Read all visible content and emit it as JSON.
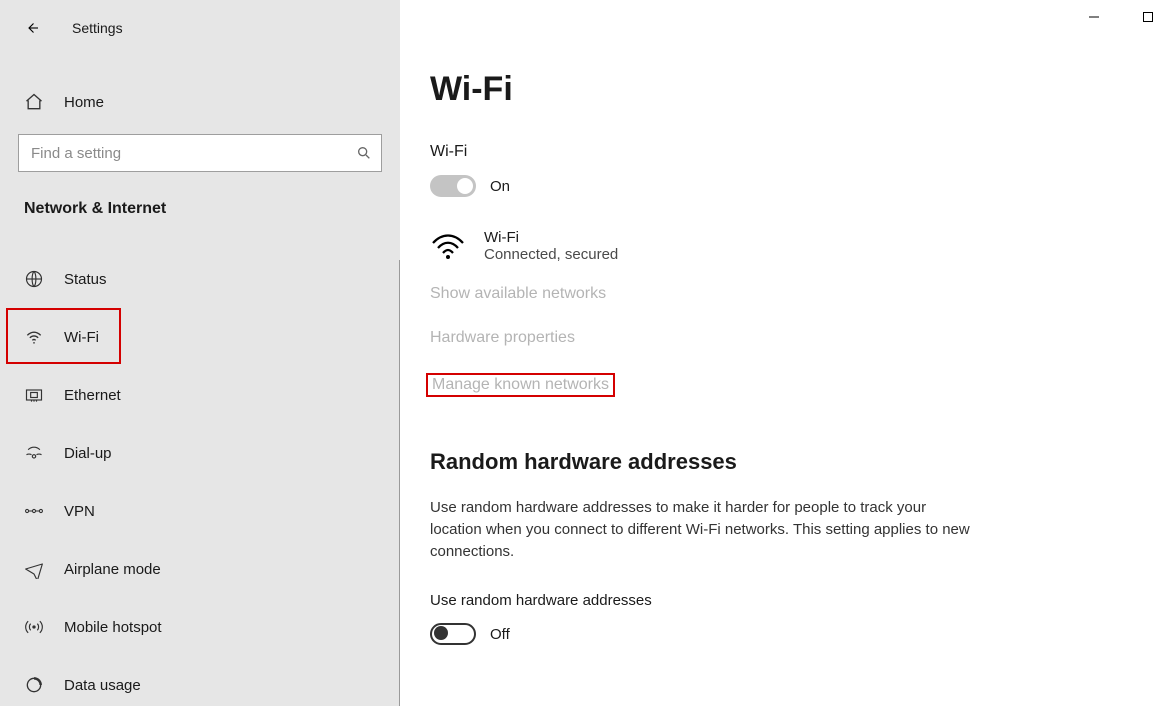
{
  "window": {
    "title": "Settings"
  },
  "sidebar": {
    "home": "Home",
    "search_placeholder": "Find a setting",
    "category": "Network & Internet",
    "items": [
      {
        "label": "Status"
      },
      {
        "label": "Wi-Fi"
      },
      {
        "label": "Ethernet"
      },
      {
        "label": "Dial-up"
      },
      {
        "label": "VPN"
      },
      {
        "label": "Airplane mode"
      },
      {
        "label": "Mobile hotspot"
      },
      {
        "label": "Data usage"
      }
    ]
  },
  "page": {
    "title": "Wi-Fi",
    "wifi_label": "Wi-Fi",
    "wifi_toggle_state": "On",
    "connection": {
      "name": "Wi-Fi",
      "status": "Connected, secured"
    },
    "links": {
      "show_available": "Show available networks",
      "hardware_props": "Hardware properties",
      "manage_known": "Manage known networks"
    },
    "random": {
      "heading": "Random hardware addresses",
      "body": "Use random hardware addresses to make it harder for people to track your location when you connect to different Wi-Fi networks. This setting applies to new connections.",
      "toggle_label": "Use random hardware addresses",
      "toggle_state": "Off"
    }
  }
}
